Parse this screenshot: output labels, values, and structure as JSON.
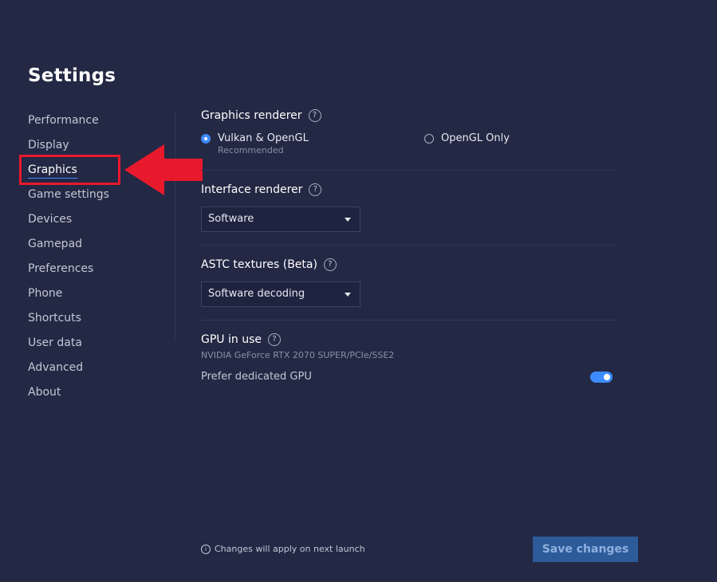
{
  "title": "Settings",
  "sidebar": {
    "items": [
      {
        "label": "Performance"
      },
      {
        "label": "Display"
      },
      {
        "label": "Graphics"
      },
      {
        "label": "Game settings"
      },
      {
        "label": "Devices"
      },
      {
        "label": "Gamepad"
      },
      {
        "label": "Preferences"
      },
      {
        "label": "Phone"
      },
      {
        "label": "Shortcuts"
      },
      {
        "label": "User data"
      },
      {
        "label": "Advanced"
      },
      {
        "label": "About"
      }
    ],
    "active": "Graphics"
  },
  "graphics_renderer": {
    "label": "Graphics renderer",
    "help": "?",
    "options": [
      {
        "label": "Vulkan & OpenGL",
        "sub": "Recommended",
        "selected": true
      },
      {
        "label": "OpenGL Only",
        "selected": false
      }
    ]
  },
  "interface_renderer": {
    "label": "Interface renderer",
    "help": "?",
    "value": "Software"
  },
  "astc_textures": {
    "label": "ASTC textures (Beta)",
    "help": "?",
    "value": "Software decoding"
  },
  "gpu": {
    "label": "GPU in use",
    "help": "?",
    "name": "NVIDIA GeForce RTX 2070 SUPER/PCIe/SSE2",
    "prefer_label": "Prefer dedicated GPU",
    "prefer_enabled": true
  },
  "footer": {
    "info_glyph": "i",
    "note": "Changes will apply on next launch",
    "save_label": "Save changes"
  },
  "colors": {
    "background": "#232844",
    "accent": "#3e8bff",
    "annotation_red": "#e8192c",
    "save_button": "#2d5a99"
  }
}
